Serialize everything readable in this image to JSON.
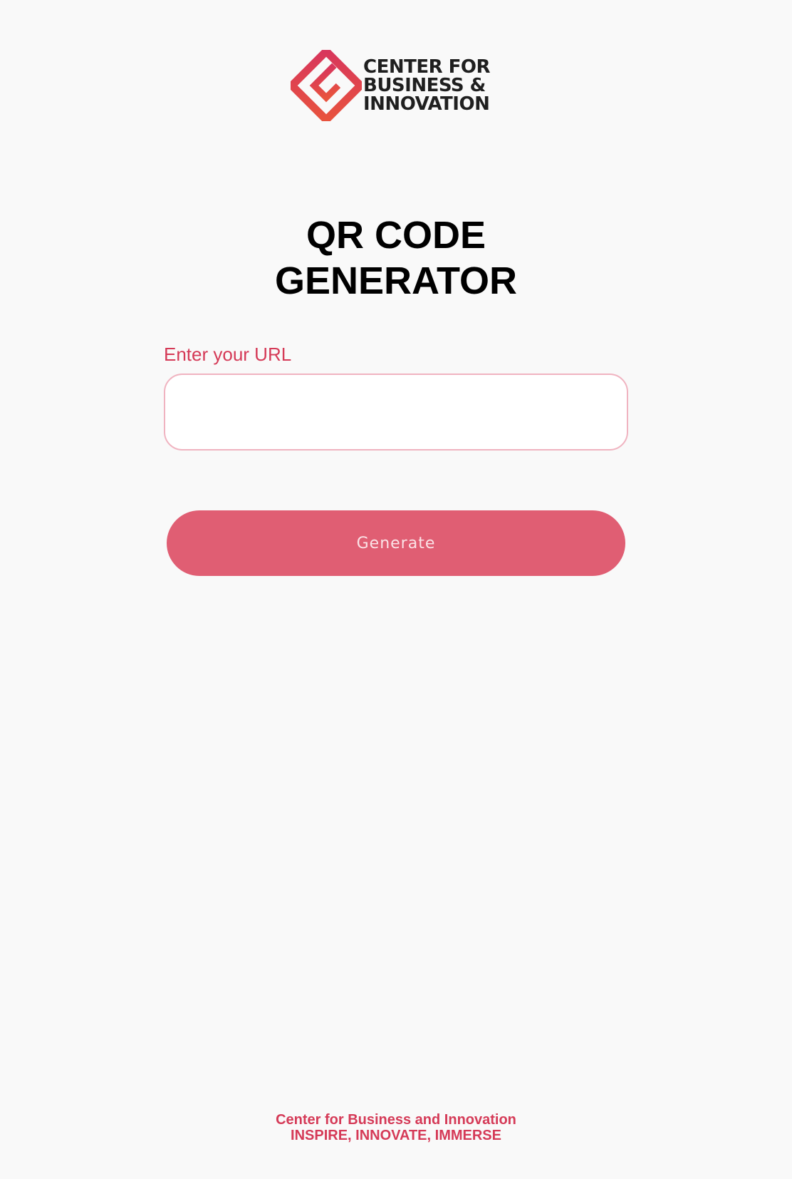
{
  "logo": {
    "line1": "CENTER FOR",
    "line2": "BUSINESS &",
    "line3": "INNOVATION",
    "icon": "cbi-diamond-logo-icon"
  },
  "title": {
    "line1": "QR CODE",
    "line2": "GENERATOR"
  },
  "form": {
    "url_label": "Enter your URL",
    "url_value": "",
    "url_placeholder": "",
    "generate_label": "Generate"
  },
  "footer": {
    "line1": "Center for Business and Innovation",
    "line2": "INSPIRE, INNOVATE, IMMERSE"
  },
  "colors": {
    "accent": "#d53a57",
    "button": "#e05e73",
    "input_border": "#f0b3c0",
    "background": "#f9f9f9"
  }
}
